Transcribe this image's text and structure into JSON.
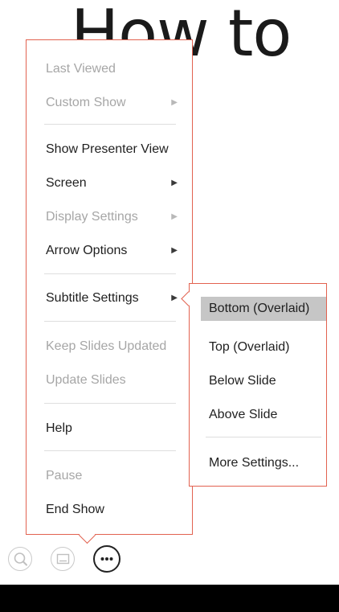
{
  "slide": {
    "title_fragment": "How to"
  },
  "menu": {
    "items": [
      {
        "label": "Last Viewed",
        "enabled": false,
        "submenu": false
      },
      {
        "label": "Custom Show",
        "enabled": false,
        "submenu": true
      },
      {
        "label": "Show Presenter View",
        "enabled": true,
        "submenu": false
      },
      {
        "label": "Screen",
        "enabled": true,
        "submenu": true
      },
      {
        "label": "Display Settings",
        "enabled": false,
        "submenu": true
      },
      {
        "label": "Arrow Options",
        "enabled": true,
        "submenu": true
      },
      {
        "label": "Subtitle Settings",
        "enabled": true,
        "submenu": true,
        "expanded": true
      },
      {
        "label": "Keep Slides Updated",
        "enabled": false,
        "submenu": false
      },
      {
        "label": "Update Slides",
        "enabled": false,
        "submenu": false
      },
      {
        "label": "Help",
        "enabled": true,
        "submenu": false
      },
      {
        "label": "Pause",
        "enabled": false,
        "submenu": false
      },
      {
        "label": "End Show",
        "enabled": true,
        "submenu": false
      }
    ]
  },
  "submenu": {
    "items": [
      {
        "label": "Bottom (Overlaid)",
        "selected": true
      },
      {
        "label": "Top (Overlaid)",
        "selected": false
      },
      {
        "label": "Below Slide",
        "selected": false
      },
      {
        "label": "Above Slide",
        "selected": false
      },
      {
        "label": "More Settings...",
        "selected": false
      }
    ]
  },
  "controls": {
    "icons": [
      "zoom-icon",
      "subtitles-icon",
      "more-options-icon"
    ],
    "active": "more-options-icon"
  },
  "colors": {
    "accent_border": "#e26250",
    "selected_bg": "#c6c6c6",
    "disabled_text": "#a6a6a6",
    "text": "#1f1f1f"
  }
}
